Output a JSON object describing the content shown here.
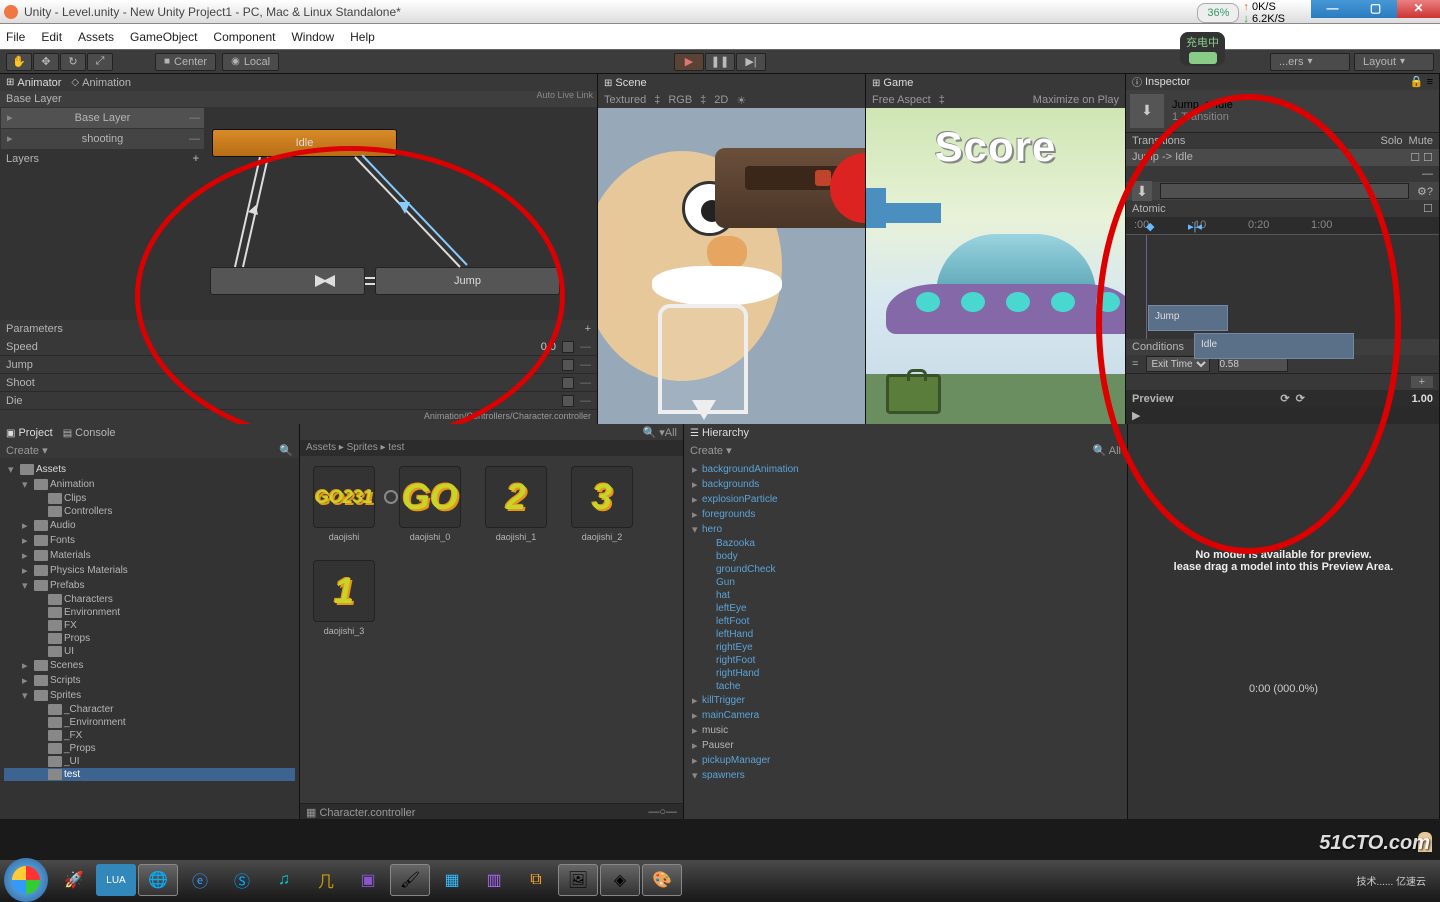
{
  "titlebar": {
    "title": "Unity - Level.unity - New Unity Project1 - PC, Mac & Linux Standalone*"
  },
  "netmon": {
    "pct": "36%",
    "up": "0K/S",
    "down": "6.2K/S"
  },
  "battery": "充电中",
  "menu": {
    "file": "File",
    "edit": "Edit",
    "assets": "Assets",
    "go": "GameObject",
    "comp": "Component",
    "window": "Window",
    "help": "Help"
  },
  "toolbar": {
    "center": "Center",
    "local": "Local",
    "layers": "...ers",
    "layout": "Layout"
  },
  "animator": {
    "tab": "Animator",
    "tab2": "Animation",
    "baselayer": "Base Layer",
    "autolive": "Auto Live Link",
    "layers": [
      "Base Layer",
      "shooting"
    ],
    "layers_label": "Layers",
    "states": {
      "idle": "Idle",
      "jump": "Jump"
    },
    "params_label": "Parameters",
    "params": [
      {
        "name": "Speed",
        "val": "0.0"
      },
      {
        "name": "Jump",
        "val": ""
      },
      {
        "name": "Shoot",
        "val": ""
      },
      {
        "name": "Die",
        "val": ""
      }
    ],
    "path": "Animation/Controllers/Character.controller"
  },
  "scene": {
    "tab": "Scene",
    "sub": {
      "textured": "Textured",
      "rgb": "RGB",
      "view": "2D"
    }
  },
  "game": {
    "tab": "Game",
    "sub": {
      "aspect": "Free Aspect",
      "max": "Maximize on Play"
    },
    "score": "Score"
  },
  "inspector": {
    "tab": "Inspector",
    "title": "Jump -> Idle",
    "subtitle": "1 Transition",
    "sec_transitions": "Transitions",
    "solo": "Solo",
    "mute": "Mute",
    "trans_item": "Jump -> Idle",
    "atomic": "Atomic",
    "ruler": {
      "t0": ":00",
      "t1": ":10",
      "t2": "0:20",
      "t3": "1:00"
    },
    "blocks": {
      "jump": "Jump",
      "idle": "Idle"
    },
    "conditions": "Conditions",
    "cond_type": "Exit Time",
    "cond_val": "0.58",
    "preview": "Preview",
    "preview_val": "1.00",
    "nomodel": "No model is available for preview.",
    "nomodel2": "lease drag a model into this Preview Area.",
    "time": "0:00 (000.0%)"
  },
  "project": {
    "tab": "Project",
    "tab2": "Console",
    "create": "Create",
    "tree": [
      {
        "n": "Assets",
        "d": 0,
        "r": 1,
        "o": 1
      },
      {
        "n": "Animation",
        "d": 1,
        "o": 1
      },
      {
        "n": "Clips",
        "d": 2
      },
      {
        "n": "Controllers",
        "d": 2
      },
      {
        "n": "Audio",
        "d": 1
      },
      {
        "n": "Fonts",
        "d": 1
      },
      {
        "n": "Materials",
        "d": 1
      },
      {
        "n": "Physics Materials",
        "d": 1
      },
      {
        "n": "Prefabs",
        "d": 1,
        "o": 1
      },
      {
        "n": "Characters",
        "d": 2
      },
      {
        "n": "Environment",
        "d": 2
      },
      {
        "n": "FX",
        "d": 2
      },
      {
        "n": "Props",
        "d": 2
      },
      {
        "n": "UI",
        "d": 2
      },
      {
        "n": "Scenes",
        "d": 1
      },
      {
        "n": "Scripts",
        "d": 1
      },
      {
        "n": "Sprites",
        "d": 1,
        "o": 1
      },
      {
        "n": "_Character",
        "d": 2
      },
      {
        "n": "_Environment",
        "d": 2
      },
      {
        "n": "_FX",
        "d": 2
      },
      {
        "n": "_Props",
        "d": 2
      },
      {
        "n": "_UI",
        "d": 2
      },
      {
        "n": "test",
        "d": 2,
        "sel": 1
      }
    ]
  },
  "assets": {
    "breadcrumb": "Assets ▸ Sprites ▸ test",
    "search_hint": "All",
    "items": [
      {
        "g": "GO231",
        "n": "daojishi",
        "mini": 1
      },
      {
        "g": "GO",
        "n": "daojishi_0"
      },
      {
        "g": "2",
        "n": "daojishi_1"
      },
      {
        "g": "3",
        "n": "daojishi_2"
      },
      {
        "g": "1",
        "n": "daojishi_3"
      }
    ],
    "footer": "Character.controller"
  },
  "hierarchy": {
    "tab": "Hierarchy",
    "create": "Create",
    "search_hint": "All",
    "items": [
      {
        "n": "backgroundAnimation",
        "d": 0
      },
      {
        "n": "backgrounds",
        "d": 0
      },
      {
        "n": "explosionParticle",
        "d": 0
      },
      {
        "n": "foregrounds",
        "d": 0
      },
      {
        "n": "hero",
        "d": 0,
        "o": 1
      },
      {
        "n": "Bazooka",
        "d": 1
      },
      {
        "n": "body",
        "d": 1
      },
      {
        "n": "groundCheck",
        "d": 1
      },
      {
        "n": "Gun",
        "d": 1
      },
      {
        "n": "hat",
        "d": 1
      },
      {
        "n": "leftEye",
        "d": 1
      },
      {
        "n": "leftFoot",
        "d": 1
      },
      {
        "n": "leftHand",
        "d": 1
      },
      {
        "n": "rightEye",
        "d": 1
      },
      {
        "n": "rightFoot",
        "d": 1
      },
      {
        "n": "rightHand",
        "d": 1
      },
      {
        "n": "tache",
        "d": 1
      },
      {
        "n": "killTrigger",
        "d": 0
      },
      {
        "n": "mainCamera",
        "d": 0
      },
      {
        "n": "music",
        "d": 0,
        "g": 1
      },
      {
        "n": "Pauser",
        "d": 0,
        "g": 1
      },
      {
        "n": "pickupManager",
        "d": 0
      },
      {
        "n": "spawners",
        "d": 0,
        "o": 1
      }
    ]
  },
  "watermark": "51CTO.com"
}
